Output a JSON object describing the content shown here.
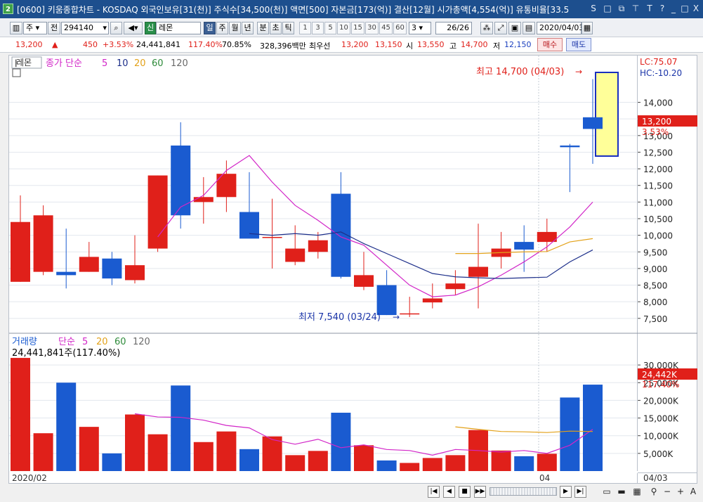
{
  "window": {
    "icon_label": "2",
    "title": "[0600] 키움종합차트 - KOSDAQ 외국인보유[31(천)] 주식수[34,500(천)] 액면[500] 자본금[173(억)] 결산[12월] 시가총액[4,554(억)] 유통비율[33.5",
    "controls": [
      "S",
      "□",
      "⧉",
      "⊤",
      "T",
      "?",
      "_",
      "□",
      "X"
    ]
  },
  "toolbar": {
    "market_type": "주",
    "prev_button": "전",
    "stock_code": "294140",
    "signal_badge": "신",
    "stock_name": "레몬",
    "periods": [
      "일",
      "주",
      "월",
      "년",
      "분",
      "초",
      "틱"
    ],
    "active_period": "일",
    "minute_presets": [
      "1",
      "3",
      "5",
      "10",
      "15",
      "30",
      "45",
      "60"
    ],
    "unit_value": "3",
    "page_count": "26/26",
    "date_value": "2020/04/03"
  },
  "quote": {
    "price": "13,200",
    "change_arrow": "▲",
    "change": "450",
    "change_pct": "+3.53%",
    "volume": "24,441,841",
    "volume_pct": "117.40%",
    "ratio": "70.85%",
    "trade_value": "328,396백만",
    "best_label": "최우선",
    "best_ask": "13,200",
    "best_bid": "13,150",
    "open_label": "시",
    "open": "13,550",
    "high_label": "고",
    "high": "14,700",
    "low_label": "저",
    "low": "12,150",
    "buy_label": "매수",
    "sell_label": "매도"
  },
  "price_panel": {
    "stock_tag": "레몬",
    "ma_label": "종가 단순",
    "ma_periods": [
      "5",
      "10",
      "20",
      "60",
      "120"
    ],
    "lc_label": "LC:75.07",
    "hc_label": "HC:-10.20",
    "high_annotation": "최고 14,700 (04/03)",
    "low_annotation": "최저 7,540 (03/24)",
    "current_price_label": "13,200",
    "current_pct_label": "3.53%",
    "y_ticks": [
      "14,000",
      "13,500",
      "13,000",
      "12,500",
      "12,000",
      "11,500",
      "11,000",
      "10,500",
      "10,000",
      "9,500",
      "9,000",
      "8,500",
      "8,000",
      "7,500"
    ]
  },
  "volume_panel": {
    "title": "거래량",
    "ma_label": "단순",
    "ma_periods": [
      "5",
      "20",
      "60",
      "120"
    ],
    "current_value": "24,441,841주(117.40%)",
    "current_tag": "24,442K",
    "current_pct_tag": "117.40%",
    "y_ticks": [
      "30,000K",
      "25,000K",
      "20,000K",
      "15,000K",
      "10,000K",
      "5,000K"
    ]
  },
  "x_axis": {
    "labels": [
      "2020/02",
      "04"
    ],
    "right_label": "04/03"
  },
  "colors": {
    "up": "#e0201a",
    "down": "#1a5bd0",
    "ma5": "#d226c8",
    "ma10": "#1d2f8a",
    "ma20": "#e3a21a",
    "ma60": "#2e8b3a",
    "ma120": "#6a6a6a",
    "highlight_fill": "#ffff99",
    "highlight_border": "#1a2fbf"
  },
  "chart_data": {
    "type": "candlestick",
    "dates_shown": [
      "2020/02",
      "04",
      "04/03"
    ],
    "candles": [
      {
        "open": 8600,
        "high": 11200,
        "low": 8600,
        "close": 10400
      },
      {
        "open": 8900,
        "high": 10900,
        "low": 8800,
        "close": 10600
      },
      {
        "open": 8900,
        "high": 10200,
        "low": 8400,
        "close": 8800
      },
      {
        "open": 8900,
        "high": 9800,
        "low": 8900,
        "close": 9350
      },
      {
        "open": 9300,
        "high": 9500,
        "low": 8500,
        "close": 8700
      },
      {
        "open": 8650,
        "high": 10000,
        "low": 8550,
        "close": 9100
      },
      {
        "open": 9600,
        "high": 11800,
        "low": 9500,
        "close": 11800
      },
      {
        "open": 12700,
        "high": 13400,
        "low": 10200,
        "close": 10600
      },
      {
        "open": 11000,
        "high": 11750,
        "low": 10350,
        "close": 11150
      },
      {
        "open": 11150,
        "high": 12250,
        "low": 10700,
        "close": 11850
      },
      {
        "open": 10700,
        "high": 11900,
        "low": 10200,
        "close": 9900
      },
      {
        "open": 9950,
        "high": 11100,
        "low": 9000,
        "close": 9950
      },
      {
        "open": 9200,
        "high": 10300,
        "low": 9100,
        "close": 9600
      },
      {
        "open": 9500,
        "high": 10100,
        "low": 9300,
        "close": 9850
      },
      {
        "open": 11250,
        "high": 11900,
        "low": 8700,
        "close": 8750
      },
      {
        "open": 8450,
        "high": 9500,
        "low": 8350,
        "close": 8800
      },
      {
        "open": 8500,
        "high": 8950,
        "low": 7600,
        "close": 7600
      },
      {
        "open": 7620,
        "high": 8150,
        "low": 7540,
        "close": 7650
      },
      {
        "open": 7980,
        "high": 8550,
        "low": 7800,
        "close": 8100
      },
      {
        "open": 8380,
        "high": 8950,
        "low": 8200,
        "close": 8550
      },
      {
        "open": 8750,
        "high": 10350,
        "low": 7800,
        "close": 9050
      },
      {
        "open": 9350,
        "high": 10100,
        "low": 9000,
        "close": 9600
      },
      {
        "open": 9800,
        "high": 10300,
        "low": 8900,
        "close": 9570
      },
      {
        "open": 9800,
        "high": 10500,
        "low": 9500,
        "close": 10100
      },
      {
        "open": 12700,
        "high": 12750,
        "low": 11300,
        "close": 12650
      },
      {
        "open": 13550,
        "high": 14700,
        "low": 12150,
        "close": 13200
      }
    ],
    "volume": [
      32000,
      10700,
      25000,
      12500,
      5000,
      16000,
      10400,
      24200,
      8200,
      11200,
      6200,
      9800,
      4500,
      5700,
      16500,
      7300,
      3000,
      2300,
      3700,
      4500,
      11600,
      5800,
      4200,
      4900,
      20800,
      24442
    ],
    "ma5": [
      null,
      null,
      null,
      null,
      null,
      null,
      9950,
      10850,
      11200,
      11950,
      12400,
      11600,
      10900,
      10450,
      9950,
      9700,
      9100,
      8500,
      8150,
      8200,
      8450,
      8800,
      9200,
      9650,
      10250,
      11000
    ],
    "ma10": [
      null,
      null,
      null,
      null,
      null,
      null,
      null,
      null,
      null,
      null,
      10050,
      10000,
      10050,
      10000,
      10100,
      9750,
      9450,
      9150,
      8850,
      8750,
      8720,
      8700,
      8720,
      8740,
      9200,
      9560
    ],
    "ma20": [
      null,
      null,
      null,
      null,
      null,
      null,
      null,
      null,
      null,
      null,
      null,
      null,
      null,
      null,
      null,
      null,
      null,
      null,
      null,
      9450,
      9450,
      9480,
      9500,
      9510,
      9800,
      9900
    ],
    "vol_ma5": [
      null,
      null,
      null,
      null,
      null,
      16200,
      15300,
      15200,
      14400,
      12900,
      12200,
      8900,
      7600,
      9000,
      6600,
      7400,
      6100,
      5800,
      4500,
      6100,
      5800,
      5400,
      5800,
      5000,
      7300,
      11800
    ],
    "vol_ma20": [
      null,
      null,
      null,
      null,
      null,
      null,
      null,
      null,
      null,
      null,
      null,
      null,
      null,
      null,
      null,
      null,
      null,
      null,
      null,
      12500,
      11800,
      11200,
      11100,
      10900,
      11300,
      11200
    ],
    "price_ylim": [
      7200,
      14900
    ],
    "volume_ylim": [
      0,
      34000
    ]
  }
}
